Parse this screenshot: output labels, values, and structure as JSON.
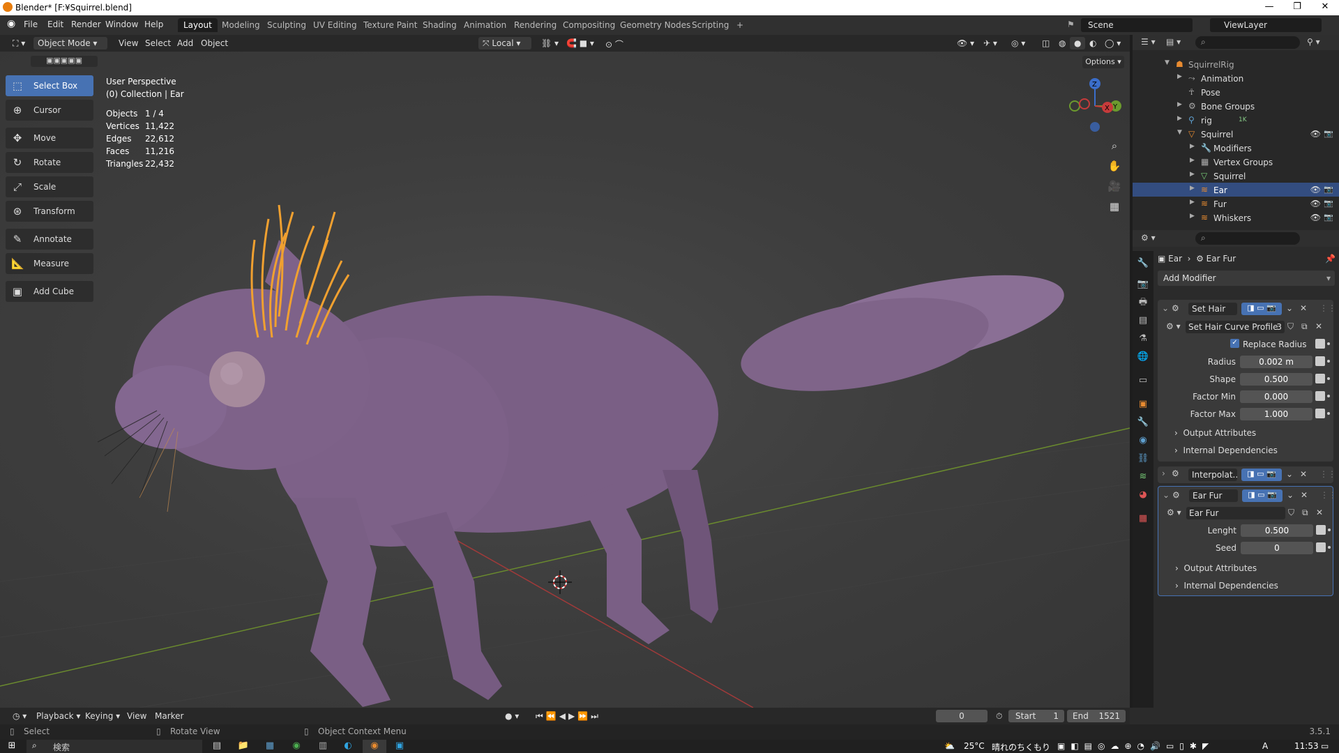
{
  "window": {
    "title": "Blender* [F:¥Squirrel.blend]",
    "minimize": "—",
    "maximize": "❐",
    "close": "✕"
  },
  "menus": [
    "File",
    "Edit",
    "Render",
    "Window",
    "Help"
  ],
  "workspaces": [
    "Layout",
    "Modeling",
    "Sculpting",
    "UV Editing",
    "Texture Paint",
    "Shading",
    "Animation",
    "Rendering",
    "Compositing",
    "Geometry Nodes",
    "Scripting",
    "+"
  ],
  "scene": {
    "label": "Scene",
    "view_layer": "ViewLayer"
  },
  "viewport_header": {
    "mode": "Object Mode",
    "menus": [
      "View",
      "Select",
      "Add",
      "Object"
    ],
    "orientation": "Local",
    "options": "Options"
  },
  "tools": [
    {
      "label": "Select Box",
      "icon": "⬚",
      "active": true
    },
    {
      "label": "Cursor",
      "icon": "⊕"
    },
    {
      "label": "Move",
      "icon": "✥"
    },
    {
      "label": "Rotate",
      "icon": "↻"
    },
    {
      "label": "Scale",
      "icon": "⤢"
    },
    {
      "label": "Transform",
      "icon": "⊛"
    },
    {
      "label": "Annotate",
      "icon": "✎"
    },
    {
      "label": "Measure",
      "icon": "📐"
    },
    {
      "label": "Add Cube",
      "icon": "▣"
    }
  ],
  "overlay": {
    "view": "User Perspective",
    "collection": "(0) Collection | Ear",
    "stats": [
      {
        "k": "Objects",
        "v": "1 / 4"
      },
      {
        "k": "Vertices",
        "v": "11,422"
      },
      {
        "k": "Edges",
        "v": "22,612"
      },
      {
        "k": "Faces",
        "v": "11,216"
      },
      {
        "k": "Triangles",
        "v": "22,432"
      }
    ]
  },
  "outliner": {
    "rows": [
      {
        "name": "SquirrelRig",
        "icon": "☗"
      },
      {
        "name": "Animation",
        "icon": "⤳"
      },
      {
        "name": "Pose",
        "icon": "☥"
      },
      {
        "name": "Bone Groups",
        "icon": "⚙"
      },
      {
        "name": "rig",
        "icon": "⚲",
        "badge": "1K"
      },
      {
        "name": "Squirrel",
        "icon": "▽"
      },
      {
        "name": "Modifiers",
        "icon": "🔧"
      },
      {
        "name": "Vertex Groups",
        "icon": "▦"
      },
      {
        "name": "Squirrel",
        "icon": "▽"
      },
      {
        "name": "Ear",
        "icon": "≋",
        "selected": true
      },
      {
        "name": "Fur",
        "icon": "≋"
      },
      {
        "name": "Whiskers",
        "icon": "≋"
      }
    ]
  },
  "properties": {
    "breadcrumb": [
      "Ear",
      "Ear Fur"
    ],
    "add_modifier": "Add Modifier",
    "mod1": {
      "title": "Set Hair C...",
      "node_group": "Set Hair Curve Profile",
      "users": "3",
      "replace_radius": "Replace Radius",
      "fields": [
        {
          "label": "Radius",
          "value": "0.002 m"
        },
        {
          "label": "Shape",
          "value": "0.500"
        },
        {
          "label": "Factor Min",
          "value": "0.000"
        },
        {
          "label": "Factor Max",
          "value": "1.000"
        }
      ],
      "output": "Output Attributes",
      "internal": "Internal Dependencies"
    },
    "mod2": {
      "title": "Interpolat..."
    },
    "mod3": {
      "title": "Ear Fur",
      "node_group": "Ear Fur",
      "fields": [
        {
          "label": "Lenght",
          "value": "0.500"
        },
        {
          "label": "Seed",
          "value": "0"
        }
      ],
      "output": "Output Attributes",
      "internal": "Internal Dependencies"
    }
  },
  "timeline": {
    "menus": [
      "Playback",
      "Keying",
      "View",
      "Marker"
    ],
    "frame": "0",
    "start_label": "Start",
    "start": "1",
    "end_label": "End",
    "end": "1521"
  },
  "status": {
    "select": "Select",
    "rotate": "Rotate View",
    "context": "Object Context Menu",
    "version": "3.5.1"
  },
  "taskbar": {
    "search": "検索",
    "temp": "25°C",
    "weather": "晴れのちくもり",
    "ime": "A",
    "time": "11:53"
  }
}
